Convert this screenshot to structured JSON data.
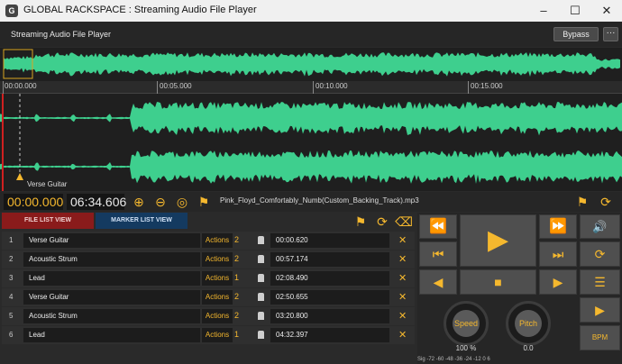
{
  "window": {
    "title": "GLOBAL RACKSPACE : Streaming Audio File Player",
    "app_icon": "G"
  },
  "header": {
    "plugin_title": "Streaming Audio File Player",
    "bypass_label": "Bypass",
    "more_label": "···"
  },
  "timeline": {
    "ticks": [
      "00:00.000",
      "00:05.000",
      "00:10.000",
      "00:15.000"
    ]
  },
  "waveform": {
    "color": "#3ecf8e"
  },
  "marker_label": "Verse Guitar",
  "transport": {
    "position": "00:00.000",
    "duration": "06:34.606",
    "file_name": "Pink_Floyd_Comfortably_Numb(Custom_Backing_Track).mp3"
  },
  "tabs": {
    "file_list": "FILE LIST VIEW",
    "marker_list": "MARKER LIST VIEW"
  },
  "markers": [
    {
      "num": "1",
      "name": "Verse Guitar",
      "actions": "Actions",
      "count": "2",
      "time": "00:00.620"
    },
    {
      "num": "2",
      "name": "Acoustic Strum",
      "actions": "Actions",
      "count": "2",
      "time": "00:57.174"
    },
    {
      "num": "3",
      "name": "Lead",
      "actions": "Actions",
      "count": "1",
      "time": "02:08.490"
    },
    {
      "num": "4",
      "name": "Verse Guitar",
      "actions": "Actions",
      "count": "2",
      "time": "02:50.655"
    },
    {
      "num": "5",
      "name": "Acoustic Strum",
      "actions": "Actions",
      "count": "2",
      "time": "03:20.800"
    },
    {
      "num": "6",
      "name": "Lead",
      "actions": "Actions",
      "count": "1",
      "time": "04:32.397"
    }
  ],
  "knobs": {
    "speed_label": "Speed",
    "speed_value": "100 %",
    "pitch_label": "Pitch",
    "pitch_value": "0.0"
  },
  "scale_text": "Sig      -72   -60   -48   -36   -24   -12    0   6",
  "bpm_label": "BPM",
  "accent_color": "#f5b82e"
}
